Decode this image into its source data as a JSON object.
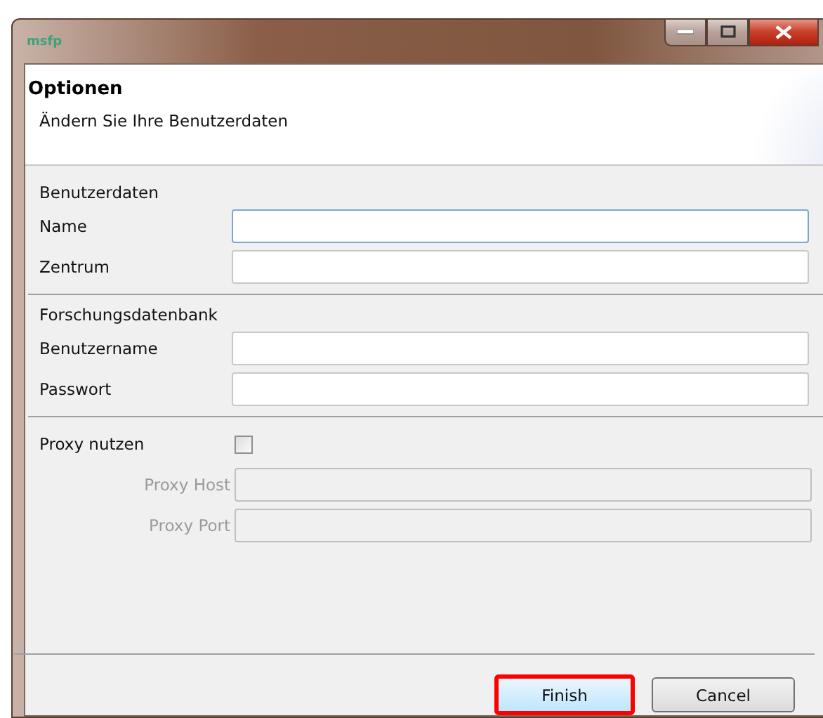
{
  "window": {
    "logo": "msfp",
    "buttons": [
      {
        "kind": "minimize"
      },
      {
        "kind": "maximize"
      },
      {
        "kind": "close"
      }
    ]
  },
  "header": {
    "title": "Optionen",
    "subtitle": "Ändern Sie Ihre Benutzerdaten"
  },
  "sections": [
    {
      "title": "Benutzerdaten",
      "rows": [
        {
          "kind": "text",
          "label": "Name",
          "focused": true,
          "disabled": false
        },
        {
          "kind": "text",
          "label": "Zentrum",
          "focused": false,
          "disabled": false
        }
      ]
    },
    {
      "title": "Forschungsdatenbank",
      "rows": [
        {
          "kind": "text",
          "label": "Benutzername",
          "focused": false,
          "disabled": false
        },
        {
          "kind": "text",
          "label": "Passwort",
          "focused": false,
          "disabled": false
        }
      ]
    },
    {
      "rows": [
        {
          "kind": "checkbox",
          "label": "Proxy nutzen",
          "checked": false
        },
        {
          "kind": "text",
          "label": "Proxy Host",
          "focused": false,
          "disabled": true
        },
        {
          "kind": "text",
          "label": "Proxy Port",
          "focused": false,
          "disabled": true
        }
      ]
    }
  ],
  "buttons": [
    {
      "label": "Finish",
      "highlighted": true
    },
    {
      "label": "Cancel",
      "highlighted": false
    }
  ]
}
